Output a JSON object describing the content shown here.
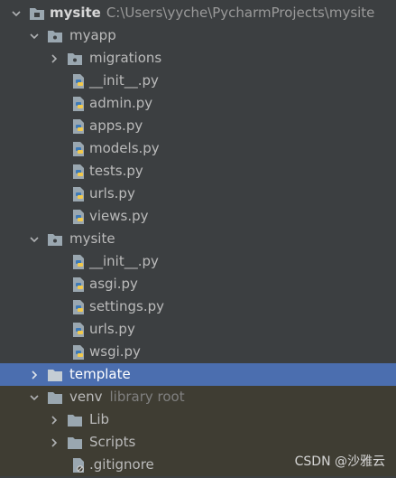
{
  "tree": {
    "root": {
      "name": "mysite",
      "path": "C:\\Users\\yyche\\PycharmProjects\\mysite"
    },
    "myapp": {
      "name": "myapp",
      "migrations": "migrations",
      "files": [
        "__init__.py",
        "admin.py",
        "apps.py",
        "models.py",
        "tests.py",
        "urls.py",
        "views.py"
      ]
    },
    "mysite_pkg": {
      "name": "mysite",
      "files": [
        "__init__.py",
        "asgi.py",
        "settings.py",
        "urls.py",
        "wsgi.py"
      ]
    },
    "template": {
      "name": "template"
    },
    "venv": {
      "name": "venv",
      "hint": "library root",
      "children": [
        "Lib",
        "Scripts"
      ],
      "gitignore": ".gitignore"
    }
  },
  "watermark": "CSDN @沙雅云"
}
